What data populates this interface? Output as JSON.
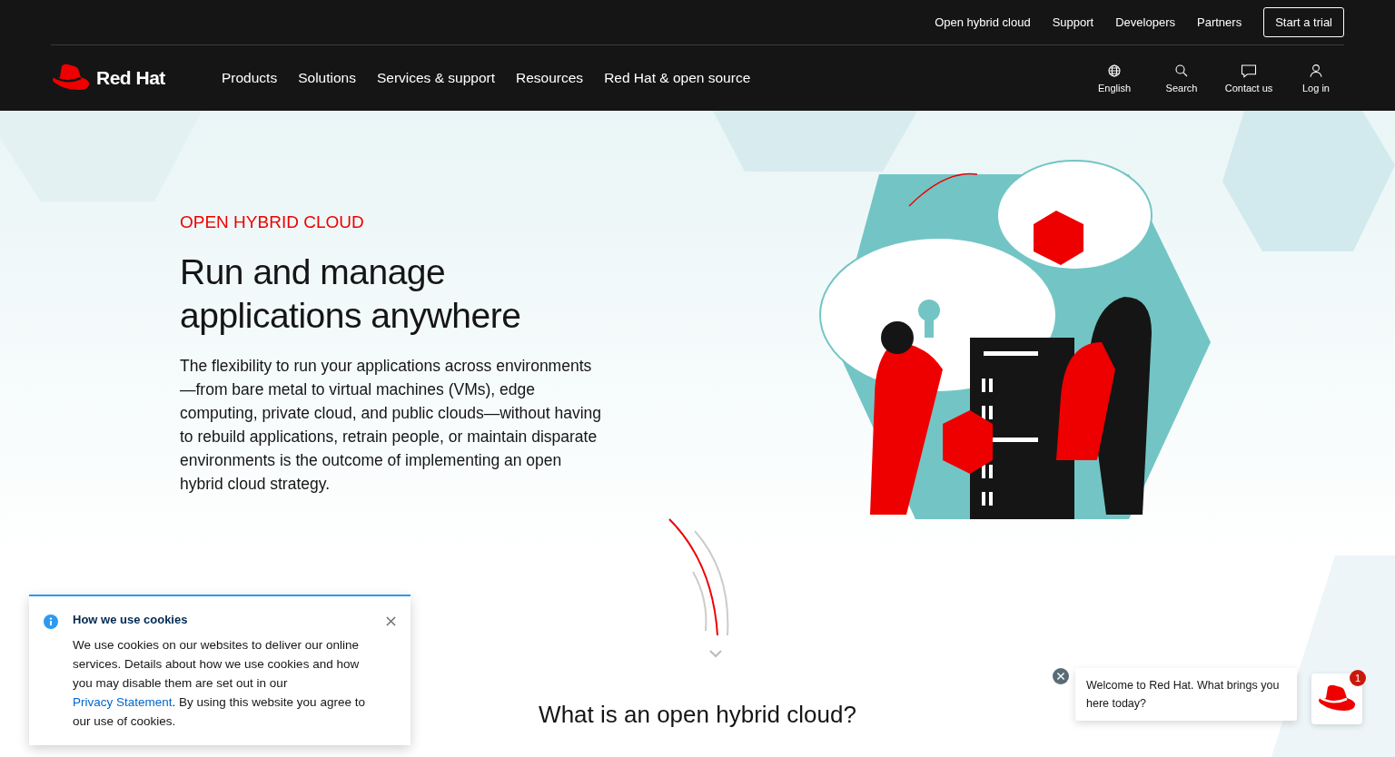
{
  "utility_nav": {
    "links": [
      "Open hybrid cloud",
      "Support",
      "Developers",
      "Partners"
    ],
    "trial_button": "Start a trial"
  },
  "main_nav": {
    "logo": "Red Hat",
    "items": [
      "Products",
      "Solutions",
      "Services & support",
      "Resources",
      "Red Hat & open source"
    ],
    "actions": [
      {
        "kind": "globe",
        "label": "English"
      },
      {
        "kind": "search",
        "label": "Search"
      },
      {
        "kind": "chat",
        "label": "Contact us"
      },
      {
        "kind": "user",
        "label": "Log in"
      }
    ]
  },
  "hero": {
    "eyebrow": "OPEN HYBRID CLOUD",
    "title": "Run and manage applications anywhere",
    "body": "The flexibility to run your applications across environments—from bare metal to virtual machines (VMs), edge computing, private cloud, and public clouds—without having to rebuild applications, retrain people, or maintain disparate environments is the outcome of implementing an open hybrid cloud strategy."
  },
  "section_heading": "What is an open hybrid cloud?",
  "cookie_notice": {
    "title": "How we use cookies",
    "body_before": "We use cookies on our websites to deliver our online services. Details about how we use cookies and how you may disable them are set out in our ",
    "link": "Privacy Statement",
    "body_after": ". By using this website you agree to our use of cookies."
  },
  "chat": {
    "message": "Welcome to Red Hat. What brings you here today?",
    "badge": "1"
  }
}
